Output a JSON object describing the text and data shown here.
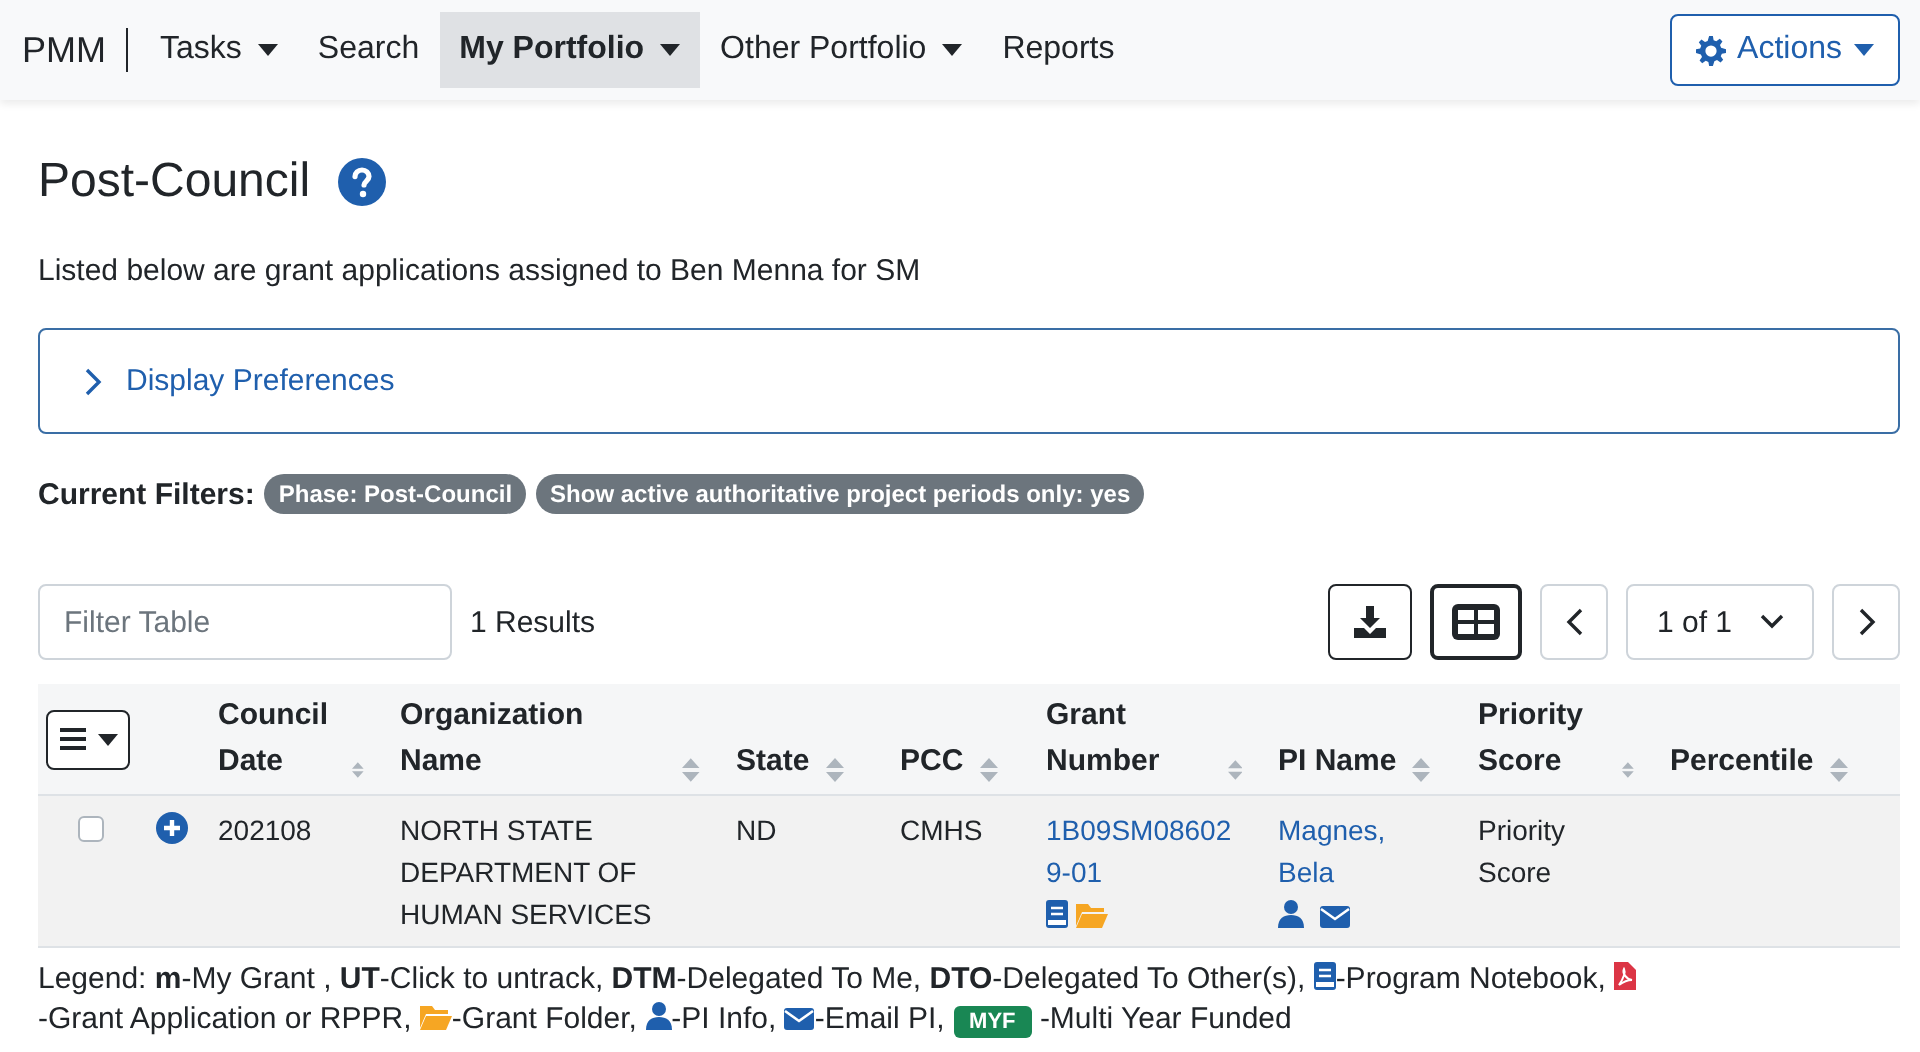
{
  "nav": {
    "brand": "PMM",
    "items": [
      {
        "label": "Tasks",
        "dropdown": true,
        "selected": false
      },
      {
        "label": "Search",
        "dropdown": false,
        "selected": false
      },
      {
        "label": "My Portfolio",
        "dropdown": true,
        "selected": true
      },
      {
        "label": "Other Portfolio",
        "dropdown": true,
        "selected": false
      },
      {
        "label": "Reports",
        "dropdown": false,
        "selected": false
      }
    ],
    "actions": {
      "label": "Actions"
    }
  },
  "page": {
    "title": "Post-Council",
    "description": "Listed below are grant applications assigned to Ben  Menna for SM",
    "preferences": {
      "label": "Display Preferences",
      "expanded": false
    },
    "filters": {
      "label": "Current Filters:",
      "tags": [
        "Phase: Post-Council",
        "Show active authoritative project periods only: yes"
      ]
    }
  },
  "toolbar": {
    "search": {
      "placeholder": "Filter Table"
    },
    "results": "1 Results",
    "page": "1 of 1"
  },
  "table": {
    "columns": [
      {
        "label": "Council Date"
      },
      {
        "label": "Organization Name"
      },
      {
        "label": "State"
      },
      {
        "label": "PCC"
      },
      {
        "label": "Grant Number"
      },
      {
        "label": "PI Name"
      },
      {
        "label": "Priority Score"
      },
      {
        "label": "Percentile"
      }
    ],
    "rows": [
      {
        "checked": false,
        "council_date": "202108",
        "organization": "NORTH  STATE DEPARTMENT OF HUMAN SERVICES",
        "state": "ND",
        "pcc": "CMHS",
        "grant_number": "1B09SM086029-01",
        "pi_name": "Magnes, Bela",
        "priority_score": "Priority Score",
        "percentile": ""
      }
    ]
  },
  "legend": [
    {
      "kind": "text",
      "text": "Legend: **m**-My Grant , **UT**-Click to untrack, **DTM**-Delegated To Me, **DTO**-Delegated To Other(s),"
    },
    {
      "kind": "notebook",
      "text": "-Program Notebook,"
    },
    {
      "kind": "pdf",
      "text": "-Grant Application or RPPR,"
    },
    {
      "kind": "folder",
      "text": "-Grant Folder,"
    },
    {
      "kind": "person",
      "text": "-PI Info,"
    },
    {
      "kind": "mail",
      "text": "-Email PI,"
    },
    {
      "kind": "badge",
      "text": "MYF"
    },
    {
      "kind": "text",
      "text": "-Multi Year Funded"
    }
  ]
}
